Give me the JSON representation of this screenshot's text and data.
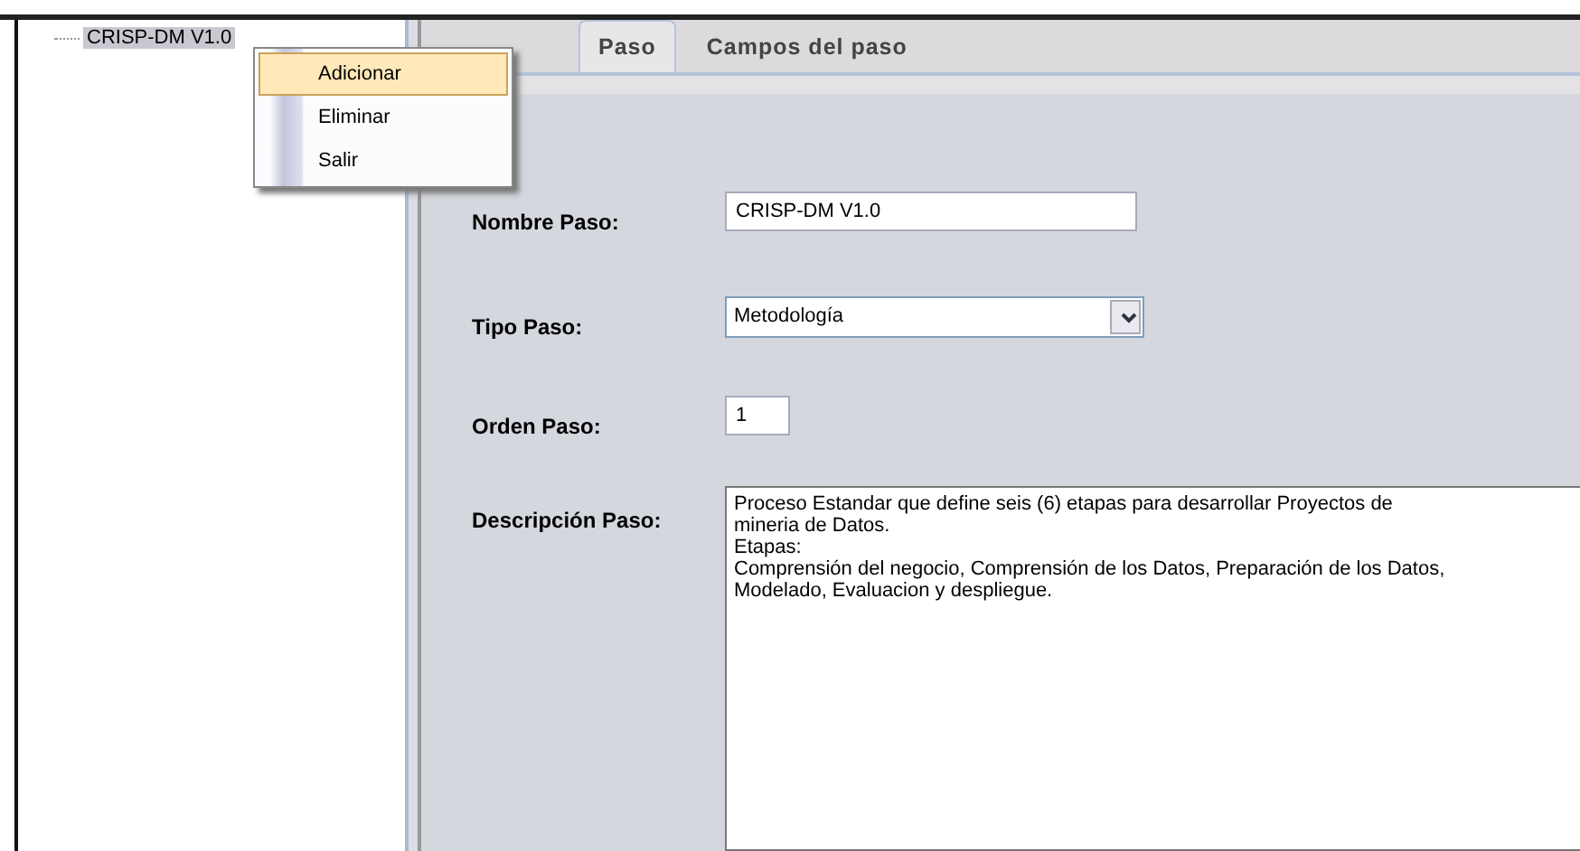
{
  "tree": {
    "items": [
      {
        "label": "CRISP-DM V1.0",
        "selected": true
      }
    ]
  },
  "context_menu": {
    "items": [
      {
        "label": "Adicionar",
        "selected": true
      },
      {
        "label": "Eliminar",
        "selected": false
      },
      {
        "label": "Salir",
        "selected": false
      }
    ]
  },
  "tabs": [
    {
      "label": "Paso",
      "selected": true
    },
    {
      "label": "Campos del paso",
      "selected": false
    }
  ],
  "form": {
    "fields": [
      {
        "kind": "text",
        "label": "Nombre Paso:",
        "value": "CRISP-DM V1.0"
      },
      {
        "kind": "select",
        "label": "Tipo Paso:",
        "value": "Metodología"
      },
      {
        "kind": "number",
        "label": "Orden Paso:",
        "value": "1"
      },
      {
        "kind": "textarea",
        "label": "Descripción Paso:",
        "lines": [
          "Proceso Estandar que define seis (6) etapas para desarrollar Proyectos de",
          "mineria de Datos.",
          "Etapas:",
          "Comprensión del negocio, Comprensión de los Datos, Preparación de los Datos,",
          "Modelado, Evaluacion y despliegue."
        ]
      }
    ]
  }
}
